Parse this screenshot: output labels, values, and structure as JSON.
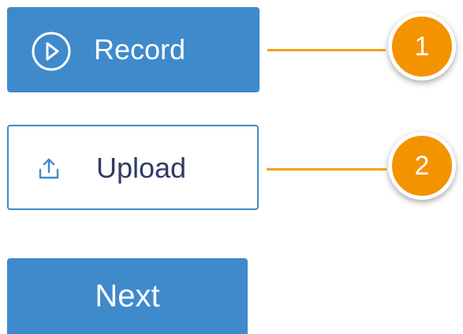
{
  "buttons": {
    "record_label": "Record",
    "upload_label": "Upload",
    "next_label": "Next"
  },
  "callouts": [
    {
      "number": "1"
    },
    {
      "number": "2"
    }
  ],
  "icons": {
    "record": "play-circle-icon",
    "upload": "upload-icon"
  },
  "colors": {
    "primary": "#3e8acb",
    "accent": "#f49300",
    "connector": "#f5a11b",
    "upload_text": "#2f3b66"
  }
}
